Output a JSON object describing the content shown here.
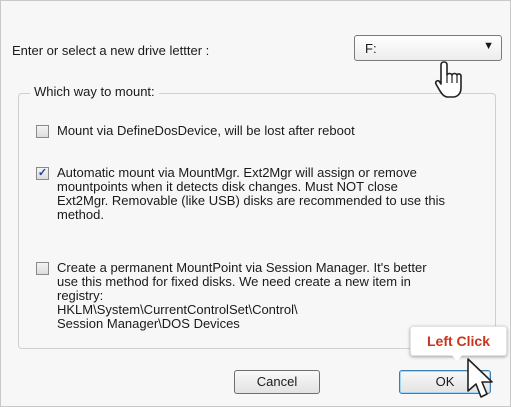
{
  "drive": {
    "label": "Enter or select a new drive lettter :",
    "selected": "F:"
  },
  "mount": {
    "title": "Which way to mount:",
    "options": [
      {
        "checked": false,
        "lines": [
          "Mount via DefineDosDevice, will be lost after reboot"
        ]
      },
      {
        "checked": true,
        "lines": [
          "Automatic mount via MountMgr. Ext2Mgr will assign or remove",
          "mountpoints when it detects disk changes. Must NOT close",
          "Ext2Mgr. Removable (like USB) disks are recommended to use this",
          "method."
        ]
      },
      {
        "checked": false,
        "lines": [
          "Create a permanent MountPoint via Session Manager. It's better",
          "use this method for fixed disks. We need create a new item in",
          "registry:",
          "HKLM\\System\\CurrentControlSet\\Control\\",
          "Session Manager\\DOS Devices"
        ]
      }
    ]
  },
  "buttons": {
    "cancel": "Cancel",
    "ok": "OK"
  },
  "annotation": {
    "tooltip": "Left Click"
  },
  "icons": {
    "hand": "hand-pointer-icon",
    "cursor": "arrow-cursor-icon",
    "dropdown": "chevron-down-icon"
  },
  "colors": {
    "tooltip_text": "#c8351c",
    "check": "#1c3f9a"
  }
}
